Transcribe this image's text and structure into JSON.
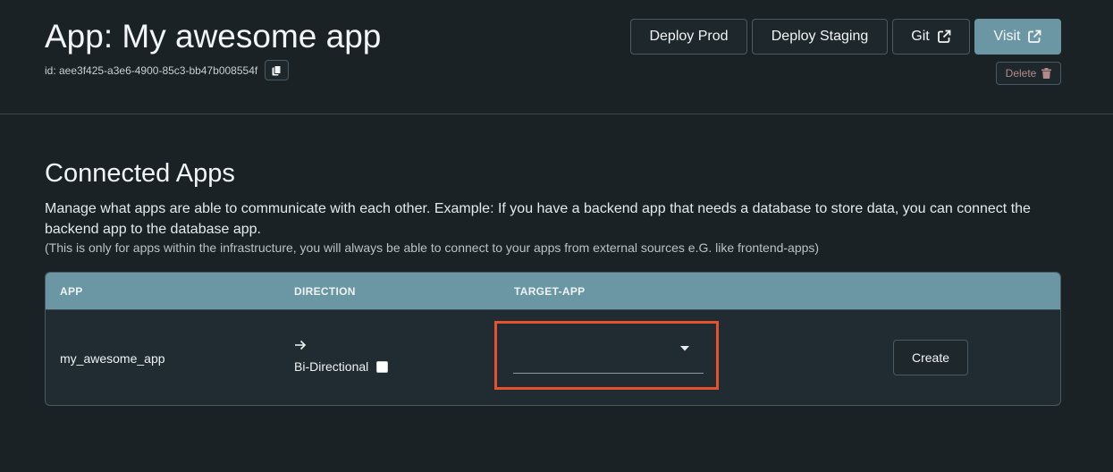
{
  "header": {
    "title": "App: My awesome app",
    "id_text": "id: aee3f425-a3e6-4900-85c3-bb47b008554f",
    "buttons": {
      "deploy_prod": "Deploy Prod",
      "deploy_staging": "Deploy Staging",
      "git": "Git",
      "visit": "Visit",
      "delete": "Delete"
    },
    "icons": {
      "copy": "copy-icon",
      "external_link": "external-link-icon",
      "trash": "trash-icon"
    }
  },
  "connected_apps": {
    "title": "Connected Apps",
    "description": "Manage what apps are able to communicate with each other. Example: If you have a backend app that needs a database to store data, you can connect the backend app to the database app.",
    "note": "(This is only for apps within the infrastructure, you will always be able to connect to your apps from external sources e.G. like frontend-apps)",
    "table": {
      "columns": [
        "APP",
        "DIRECTION",
        "TARGET-APP"
      ],
      "row": {
        "app": "my_awesome_app",
        "direction_icon": "arrow-right-icon",
        "bidirectional_label": "Bi-Directional",
        "bidirectional_checked": false,
        "target_app_value": "",
        "create_label": "Create"
      }
    }
  },
  "colors": {
    "background": "#1a2226",
    "accent": "#6a97a3",
    "highlight": "#e5532e",
    "delete_text": "#b38a88"
  }
}
